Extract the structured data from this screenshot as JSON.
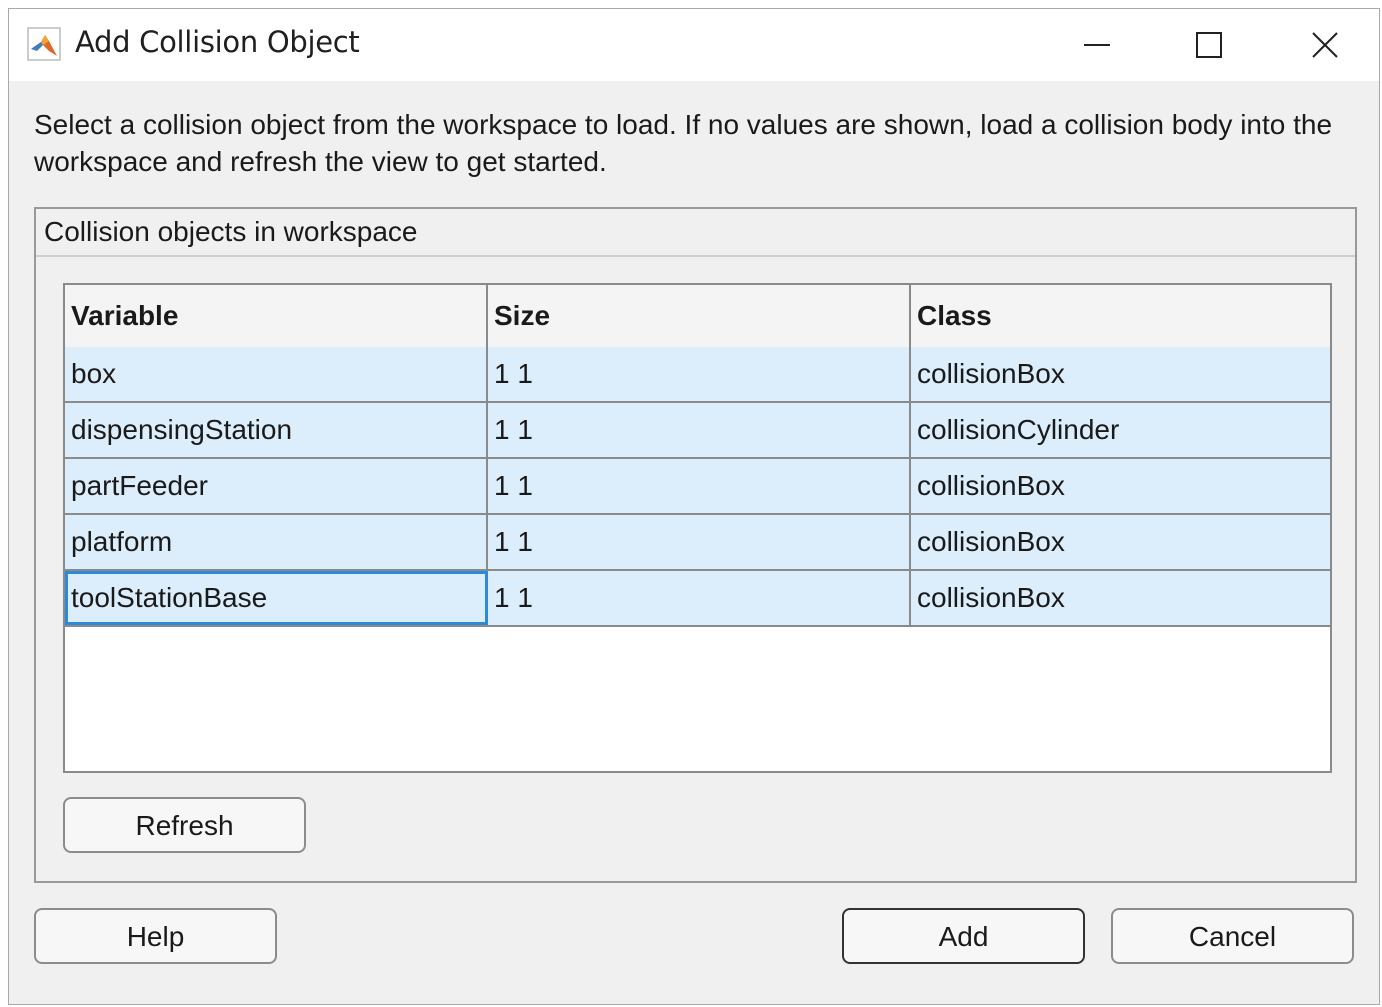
{
  "window": {
    "title": "Add Collision Object",
    "icon": "matlab-logo-icon",
    "controls": [
      "minimize-icon",
      "maximize-icon",
      "close-icon"
    ]
  },
  "instructions": "Select a collision object from the workspace to load. If no values are shown, load a collision body into the workspace and refresh the view to get started.",
  "panel": {
    "title": "Collision objects in workspace",
    "table": {
      "columns": [
        "Variable",
        "Size",
        "Class"
      ],
      "rows": [
        [
          "box",
          "1 1",
          "collisionBox"
        ],
        [
          "dispensingStation",
          "1 1",
          "collisionCylinder"
        ],
        [
          "partFeeder",
          "1 1",
          "collisionBox"
        ],
        [
          "platform",
          "1 1",
          "collisionBox"
        ],
        [
          "toolStationBase",
          "1 1",
          "collisionBox"
        ]
      ],
      "selected_cell": "toolStationBase",
      "row_color": "#dcedfc",
      "selection_color": "#2b8ad9"
    },
    "refresh_label": "Refresh"
  },
  "buttons": {
    "help": "Help",
    "add": "Add",
    "cancel": "Cancel"
  }
}
